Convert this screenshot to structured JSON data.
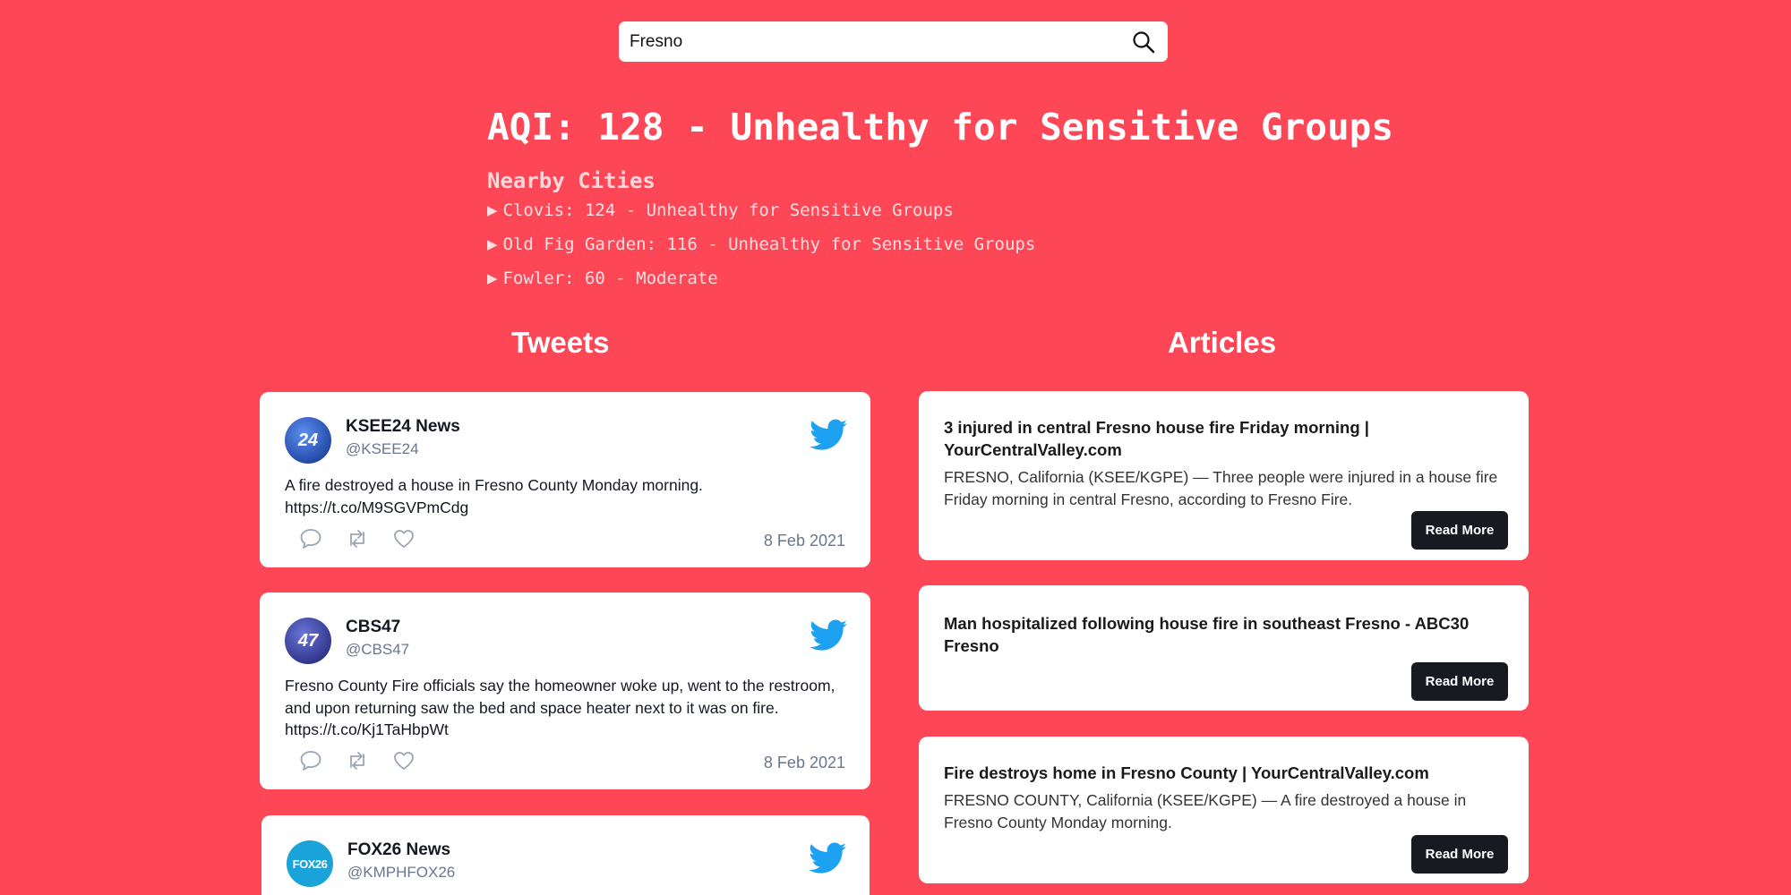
{
  "search": {
    "value": "Fresno"
  },
  "aqi": {
    "title": "AQI: 128 - Unhealthy for Sensitive Groups"
  },
  "nearby": {
    "title": "Nearby Cities",
    "items": [
      {
        "marker": "▶",
        "label": "Clovis: 124 - Unhealthy for Sensitive Groups"
      },
      {
        "marker": "▶",
        "label": "Old Fig Garden: 116 - Unhealthy for Sensitive Groups"
      },
      {
        "marker": "▶",
        "label": "Fowler: 60 - Moderate"
      }
    ]
  },
  "tweets_section": {
    "title": "Tweets"
  },
  "articles_section": {
    "title": "Articles"
  },
  "tweets": [
    {
      "name": "KSEE24 News",
      "handle": "@KSEE24",
      "avatar_text": "24",
      "avatar_color": "#1d4fb8",
      "text": "A fire destroyed a house in Fresno County Monday morning. https://t.co/M9SGVPmCdg",
      "date": "8 Feb 2021"
    },
    {
      "name": "CBS47",
      "handle": "@CBS47",
      "avatar_text": "47",
      "avatar_color": "#2a2f8f",
      "text": "Fresno County Fire officials say the homeowner woke up, went to the restroom, and upon returning saw the bed and space heater next to it was on fire. https://t.co/Kj1TaHbpWt",
      "date": "8 Feb 2021"
    },
    {
      "name": "FOX26 News",
      "handle": "@KMPHFOX26",
      "avatar_text": "FOX26",
      "avatar_color": "#1aa3d9",
      "text": "",
      "date": ""
    }
  ],
  "articles": [
    {
      "title": "3 injured in central Fresno house fire Friday morning | YourCentralValley.com",
      "description": "FRESNO, California (KSEE/KGPE) — Three people were injured in a house fire Friday morning in central Fresno, according to Fresno Fire.",
      "button": "Read More"
    },
    {
      "title": "Man hospitalized following house fire in southeast Fresno - ABC30 Fresno",
      "description": "",
      "button": "Read More"
    },
    {
      "title": "Fire destroys home in Fresno County | YourCentralValley.com",
      "description": "FRESNO COUNTY, California (KSEE/KGPE) — A fire destroyed a house in Fresno County Monday morning.",
      "button": "Read More"
    }
  ],
  "colors": {
    "background": "#fe4756",
    "twitter_blue": "#1da1f2",
    "button_dark": "#171a21"
  }
}
